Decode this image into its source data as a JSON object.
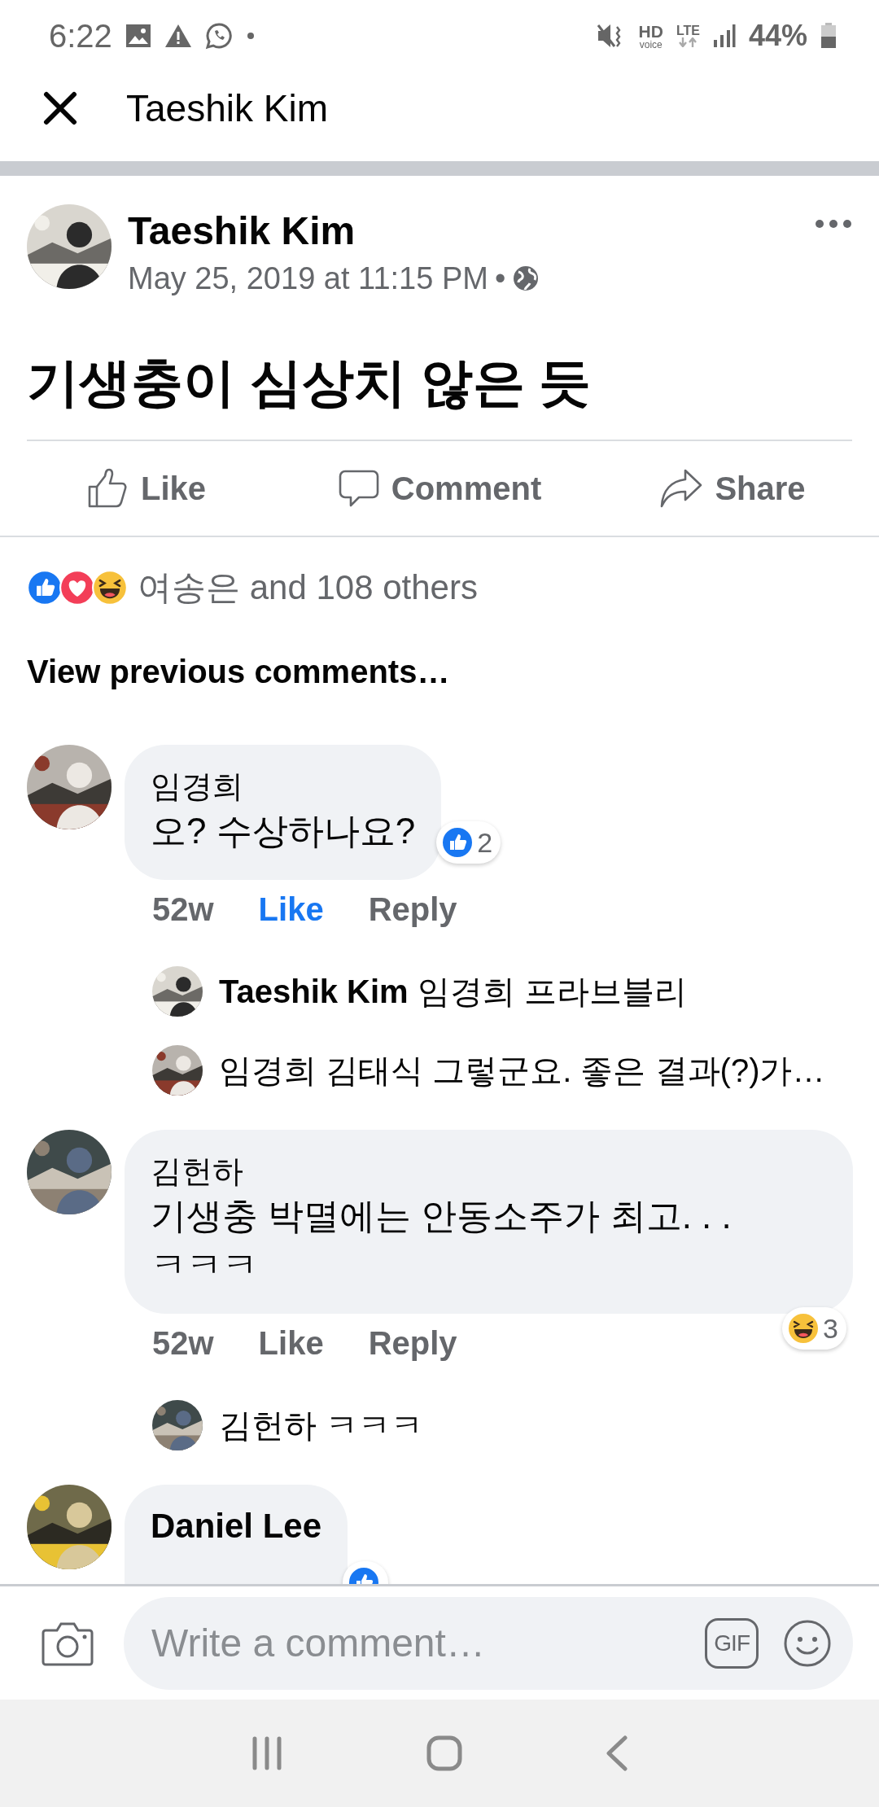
{
  "status_bar": {
    "time": "6:22",
    "hd": "HD",
    "voice": "voice",
    "network": "LTE",
    "battery": "44%"
  },
  "top_bar": {
    "title": "Taeshik Kim"
  },
  "post": {
    "author": "Taeshik Kim",
    "timestamp": "May 25, 2019 at 11:15 PM",
    "separator": "•",
    "text": "기생충이 심상치 않은 듯"
  },
  "actions": [
    {
      "kind": "like",
      "label": "Like"
    },
    {
      "kind": "comment",
      "label": "Comment"
    },
    {
      "kind": "share",
      "label": "Share"
    }
  ],
  "reactions": {
    "types": [
      {
        "kind": "like"
      },
      {
        "kind": "love"
      },
      {
        "kind": "haha"
      }
    ],
    "summary": "여송은 and 108 others"
  },
  "view_previous": "View previous comments…",
  "comments": [
    {
      "author": "임경희",
      "text": "오? 수상하나요?",
      "reaction": {
        "kind": "like",
        "count": "2"
      },
      "time": "52w",
      "like": "Like",
      "liked": true,
      "reply": "Reply",
      "replies": [
        {
          "author": "Taeshik Kim",
          "text": "임경희 프라브블리"
        },
        {
          "author": "임경희",
          "text": "김태식 그렇군요. 좋은 결과(?)가…"
        }
      ]
    },
    {
      "author": "김헌하",
      "text": "기생충 박멸에는 안동소주가 최고. . .\nㅋㅋㅋ",
      "reaction": {
        "kind": "haha",
        "count": "3"
      },
      "time": "52w",
      "like": "Like",
      "liked": false,
      "reply": "Reply",
      "replies": [
        {
          "author": "김헌하",
          "text": "ㅋㅋㅋ"
        }
      ]
    },
    {
      "author": "Daniel Lee",
      "reaction": {
        "kind": "like"
      }
    }
  ],
  "composer": {
    "placeholder": "Write a comment…",
    "gif": "GIF"
  }
}
